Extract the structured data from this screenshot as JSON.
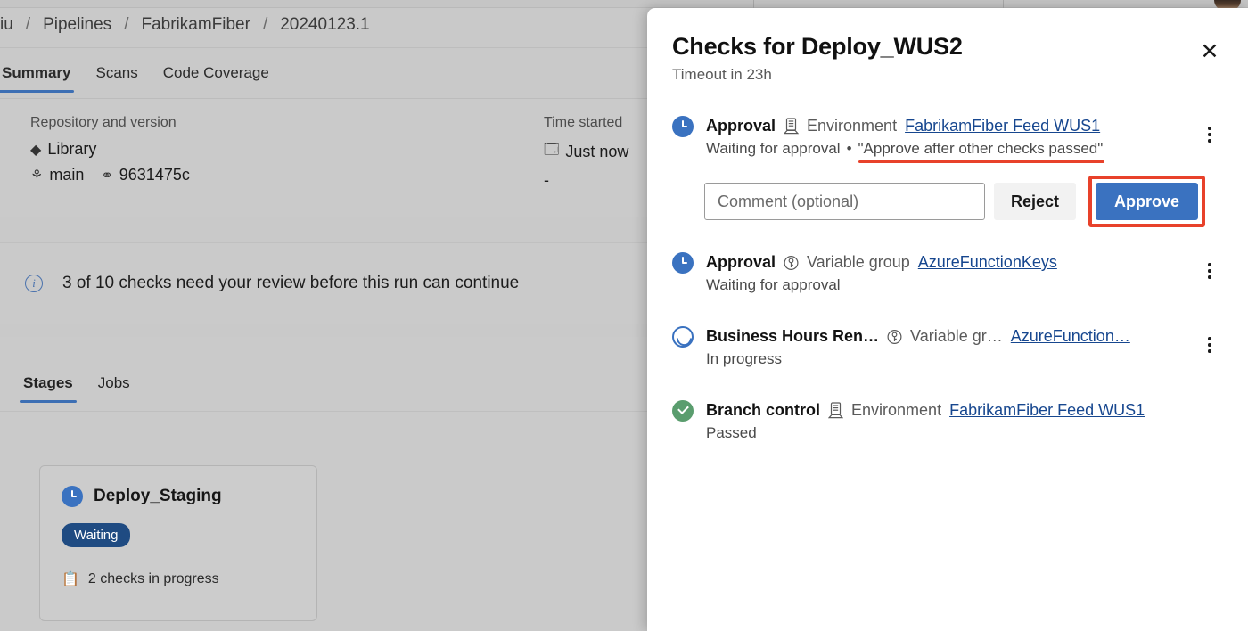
{
  "background": {
    "breadcrumb": [
      "iu",
      "Pipelines",
      "FabrikamFiber",
      "20240123.1"
    ],
    "separator": "/",
    "tabs": [
      {
        "label": "Summary",
        "active": true
      },
      {
        "label": "Scans",
        "active": false
      },
      {
        "label": "Code Coverage",
        "active": false
      }
    ],
    "summary": {
      "repo_label": "Repository and version",
      "repo_name": "Library",
      "branch": "main",
      "commit": "9631475c",
      "time_label": "Time started",
      "time_value": "Just now",
      "time_elapsed": "-"
    },
    "banner": {
      "icon": "info-icon",
      "text": "3 of 10 checks need your review before this run can continue"
    },
    "stage_tabs": [
      {
        "label": "Stages",
        "active": true
      },
      {
        "label": "Jobs",
        "active": false
      }
    ],
    "stage_card": {
      "icon": "clock-icon",
      "title": "Deploy_Staging",
      "badge": "Waiting",
      "checks_icon": "checklist-icon",
      "checks_text": "2 checks in progress"
    }
  },
  "panel": {
    "title": "Checks for Deploy_WUS2",
    "subtitle": "Timeout in 23h",
    "close_label": "✕",
    "checks": [
      {
        "status_icon": "clock-icon",
        "name": "Approval",
        "resource_icon": "environment-icon",
        "resource_kind": "Environment",
        "resource_link": "FabrikamFiber Feed WUS1",
        "state": "Waiting for approval",
        "separator": "•",
        "instructions": "\"Approve after other checks passed\"",
        "annotated": true,
        "has_actions": true,
        "menu_icon": "kebab-menu-icon"
      },
      {
        "status_icon": "clock-icon",
        "name": "Approval",
        "resource_icon": "variable-group-icon",
        "resource_kind": "Variable group",
        "resource_link": "AzureFunctionKeys",
        "state": "Waiting for approval",
        "separator": "",
        "instructions": "",
        "annotated": false,
        "has_actions": false,
        "menu_icon": "kebab-menu-icon"
      },
      {
        "status_icon": "progress-icon",
        "name": "Business Hours Ren…",
        "resource_icon": "variable-group-icon",
        "resource_kind": "Variable gr…",
        "resource_link": "AzureFunction…",
        "state": "In progress",
        "separator": "",
        "instructions": "",
        "annotated": false,
        "has_actions": false,
        "menu_icon": "kebab-menu-icon"
      },
      {
        "status_icon": "check-icon",
        "name": "Branch control",
        "resource_icon": "environment-icon",
        "resource_kind": "Environment",
        "resource_link": "FabrikamFiber Feed WUS1",
        "state": "Passed",
        "separator": "",
        "instructions": "",
        "annotated": false,
        "has_actions": false,
        "menu_icon": ""
      }
    ],
    "actions": {
      "comment_placeholder": "Comment (optional)",
      "comment_value": "",
      "reject_label": "Reject",
      "approve_label": "Approve"
    }
  },
  "colors": {
    "accent_blue": "#3a72c0",
    "link_blue": "#17478f",
    "annotation_red": "#e8412a",
    "success_green": "#5a9d6e",
    "badge_navy": "#1f4b82",
    "page_backdrop": "#c9c9c9"
  }
}
